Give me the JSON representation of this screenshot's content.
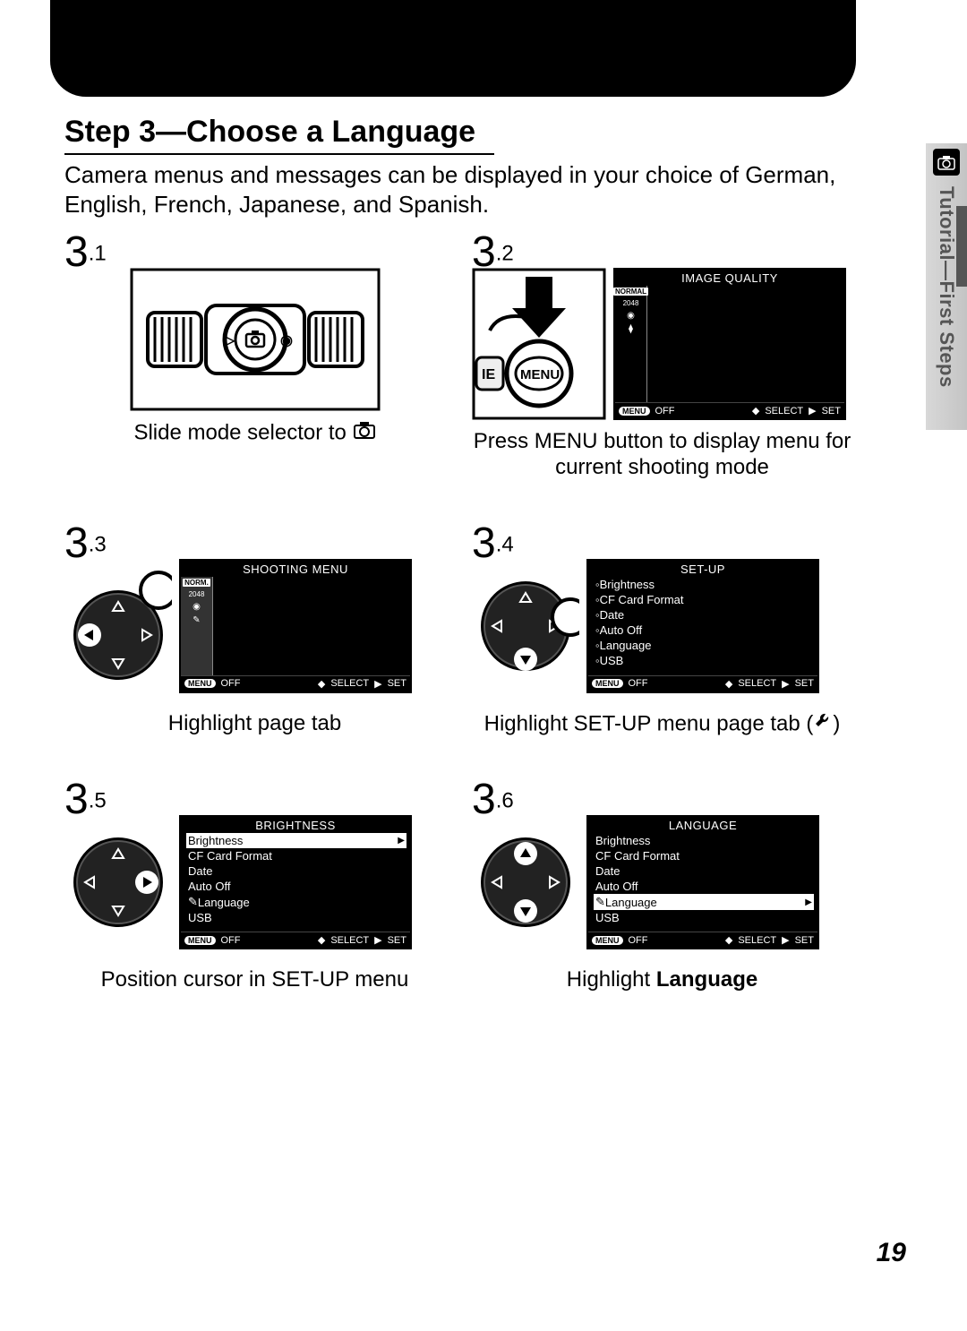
{
  "side_tab": {
    "section": "Tutorial—First Steps"
  },
  "heading": "Step 3—Choose a Language",
  "intro": "Camera menus and messages can be displayed in your choice of German, English, French, Japanese, and Spanish.",
  "steps": {
    "s1": {
      "major": "3",
      "minor": ".1",
      "caption": "Slide mode selector to "
    },
    "s2": {
      "major": "3",
      "minor": ".2",
      "caption": "Press MENU button to display menu for current shooting mode"
    },
    "s3": {
      "major": "3",
      "minor": ".3",
      "caption": "Highlight page tab"
    },
    "s4": {
      "major": "3",
      "minor": ".4",
      "caption_pre": "Highlight SET-UP menu page tab (",
      "caption_post": ")"
    },
    "s5": {
      "major": "3",
      "minor": ".5",
      "caption": "Position cursor in SET-UP menu"
    },
    "s6": {
      "major": "3",
      "minor": ".6",
      "caption_pre": "Highlight ",
      "caption_bold": "Language"
    }
  },
  "lcd": {
    "footer": {
      "menu": "MENU",
      "off": "OFF",
      "select": "SELECT",
      "set": "SET"
    },
    "image_quality": {
      "title": "IMAGE QUALITY",
      "badge": "NORMAL",
      "res": "2048"
    },
    "shooting_menu": {
      "title": "SHOOTING MENU",
      "badge": "NORM.",
      "res": "2048"
    },
    "setup": {
      "title": "SET-UP",
      "items": [
        "Brightness",
        "CF Card Format",
        "Date",
        "Auto Off",
        "Language",
        "USB"
      ]
    },
    "brightness": {
      "title": "BRIGHTNESS",
      "items": [
        "Brightness",
        "CF Card Format",
        "Date",
        "Auto Off",
        "Language",
        "USB"
      ],
      "highlight_index": 0
    },
    "language": {
      "title": "LANGUAGE",
      "items": [
        "Brightness",
        "CF Card Format",
        "Date",
        "Auto Off",
        "Language",
        "USB"
      ],
      "highlight_index": 4
    }
  },
  "page_number": "19"
}
